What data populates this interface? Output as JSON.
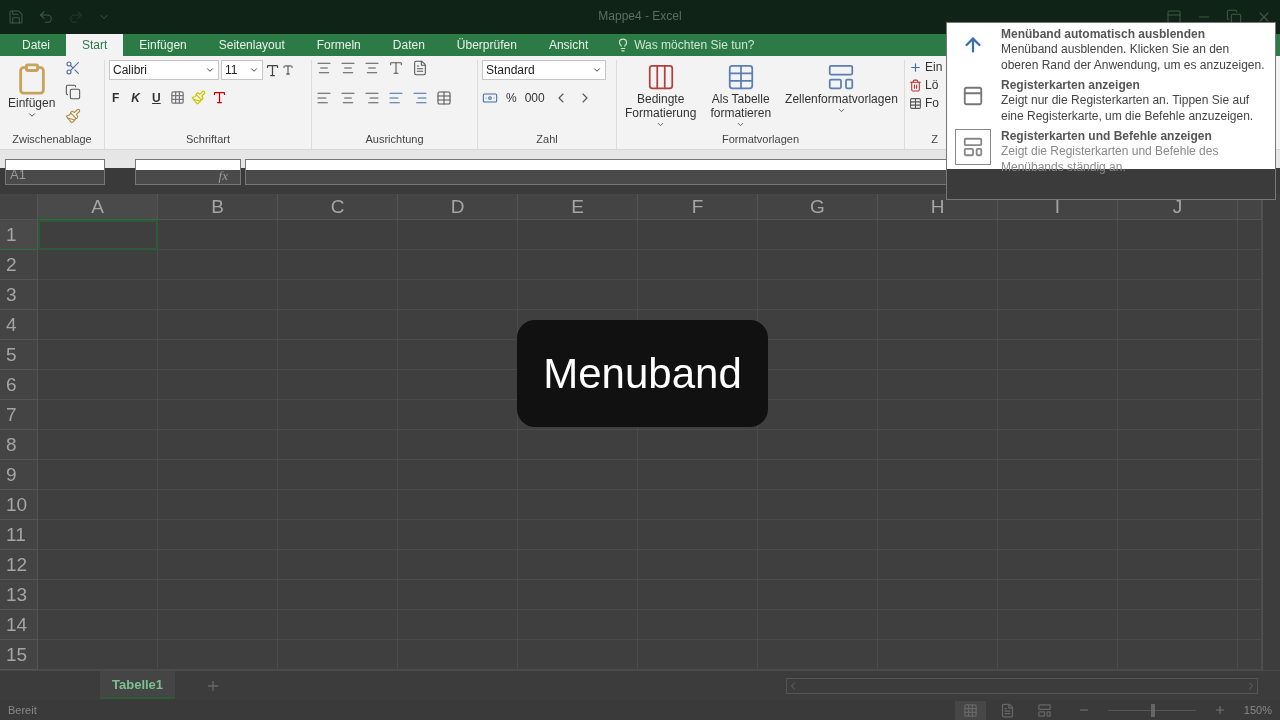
{
  "window": {
    "title": "Mappe4 - Excel"
  },
  "tabs": [
    {
      "label": "Datei",
      "selected": false
    },
    {
      "label": "Start",
      "selected": true
    },
    {
      "label": "Einfügen",
      "selected": false
    },
    {
      "label": "Seitenlayout",
      "selected": false
    },
    {
      "label": "Formeln",
      "selected": false
    },
    {
      "label": "Daten",
      "selected": false
    },
    {
      "label": "Überprüfen",
      "selected": false
    },
    {
      "label": "Ansicht",
      "selected": false
    }
  ],
  "tell_me": {
    "placeholder": "Was möchten Sie tun?"
  },
  "ribbon": {
    "clipboard": {
      "paste": "Einfügen",
      "label": "Zwischenablage"
    },
    "font": {
      "name": "Calibri",
      "size": "11",
      "bold": "F",
      "italic": "K",
      "underline": "U",
      "label": "Schriftart"
    },
    "alignment": {
      "label": "Ausrichtung"
    },
    "number": {
      "format": "Standard",
      "percent": "%",
      "thousands": "000",
      "label": "Zahl"
    },
    "styles": {
      "buttons": [
        {
          "lines": [
            "Bedingte",
            "Formatierung"
          ],
          "kind": "conditional"
        },
        {
          "lines": [
            "Als Tabelle",
            "formatieren"
          ],
          "kind": "table"
        },
        {
          "lines": [
            "Zellenformatvorlagen"
          ],
          "kind": "cellstyle"
        }
      ],
      "label": "Formatvorlagen"
    },
    "cells": {
      "items": [
        "Ein",
        "Lö",
        "Fo"
      ],
      "label": "Z"
    }
  },
  "formula_bar": {
    "name_box": "A1",
    "function": "fx"
  },
  "columns": [
    {
      "label": "A",
      "selected": true
    },
    {
      "label": "B",
      "selected": false
    },
    {
      "label": "C",
      "selected": false
    },
    {
      "label": "D",
      "selected": false
    },
    {
      "label": "E",
      "selected": false
    },
    {
      "label": "F",
      "selected": false
    },
    {
      "label": "G",
      "selected": false
    },
    {
      "label": "H",
      "selected": false
    },
    {
      "label": "I",
      "selected": false
    },
    {
      "label": "J",
      "selected": false
    }
  ],
  "rows": [
    {
      "label": "1",
      "selected": true
    },
    {
      "label": "2",
      "selected": false
    },
    {
      "label": "3",
      "selected": false
    },
    {
      "label": "4",
      "selected": false
    },
    {
      "label": "5",
      "selected": false
    },
    {
      "label": "6",
      "selected": false
    },
    {
      "label": "7",
      "selected": false
    },
    {
      "label": "8",
      "selected": false
    },
    {
      "label": "9",
      "selected": false
    },
    {
      "label": "10",
      "selected": false
    },
    {
      "label": "11",
      "selected": false
    },
    {
      "label": "12",
      "selected": false
    },
    {
      "label": "13",
      "selected": false
    },
    {
      "label": "14",
      "selected": false
    },
    {
      "label": "15",
      "selected": false
    }
  ],
  "sheet_tabs": [
    {
      "label": "Tabelle1",
      "selected": true
    }
  ],
  "status_bar": {
    "status": "Bereit",
    "views": [
      {
        "kind": "normal",
        "selected": true
      },
      {
        "kind": "layout",
        "selected": false
      },
      {
        "kind": "pagebreak",
        "selected": false
      }
    ],
    "zoom": {
      "level": 0.51,
      "reading": "150%"
    }
  },
  "ribbon_options_menu": [
    {
      "kind": "autohide",
      "title": "Menüband automatisch ausblenden",
      "description": "Menüband ausblenden. Klicken Sie an den oberen Rand der Anwendung, um es anzuzeigen.",
      "selected": false
    },
    {
      "kind": "tabs",
      "title": "Registerkarten anzeigen",
      "description": "Zeigt nur die Registerkarten an. Tippen Sie auf eine Registerkarte, um die Befehle anzuzeigen.",
      "selected": false
    },
    {
      "kind": "full",
      "title": "Registerkarten und Befehle anzeigen",
      "description": "Zeigt die Registerkarten und Befehle des Menübands ständig an.",
      "selected": true
    }
  ],
  "caption": "Menuband"
}
